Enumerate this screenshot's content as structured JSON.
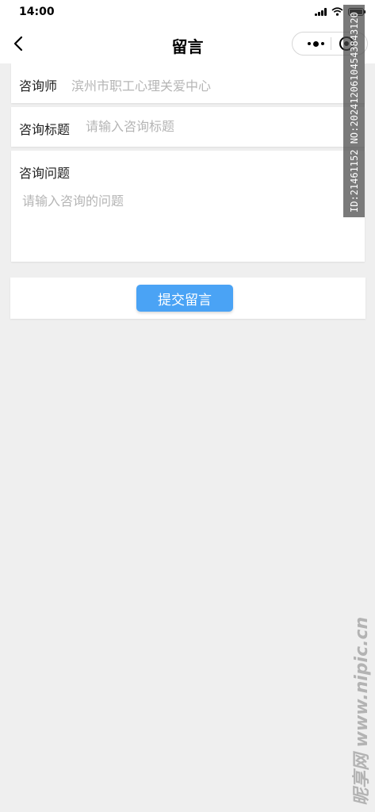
{
  "status_bar": {
    "time": "14:00",
    "icons": [
      "signal-icon",
      "wifi-icon",
      "battery-icon"
    ]
  },
  "nav": {
    "title": "留言",
    "back_icon": "chevron-left-icon",
    "more_icon": "more-dots-icon",
    "close_icon": "target-close-icon"
  },
  "form": {
    "consultant": {
      "label": "咨询师",
      "value": "滨州市职工心理关爱中心"
    },
    "title_field": {
      "label": "咨询标题",
      "placeholder": "请输入咨询标题"
    },
    "question_field": {
      "label": "咨询问题",
      "placeholder": "请输入咨询的问题"
    }
  },
  "submit": {
    "label": "提交留言"
  },
  "colors": {
    "background": "#efefef",
    "primary_button": "#4aa3f5",
    "placeholder": "#b5b5b5"
  },
  "watermark": {
    "id_text": "ID:21461152 NO:20241206104543843120",
    "brand": "昵享网 www.nipic.cn"
  }
}
